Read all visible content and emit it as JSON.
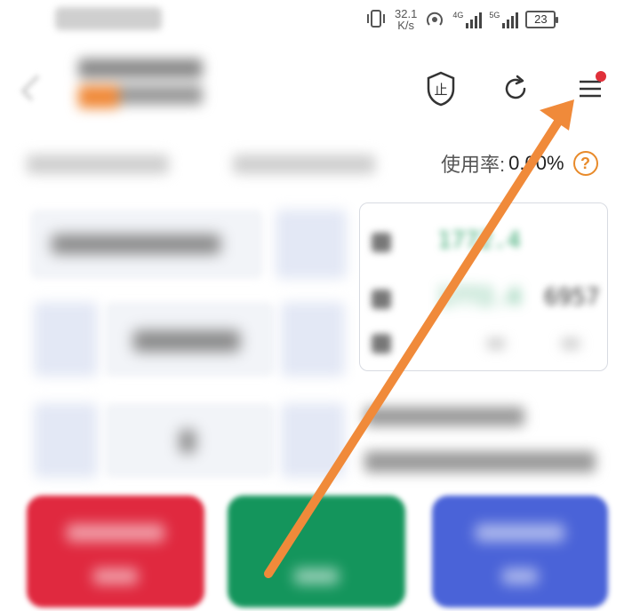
{
  "status_bar": {
    "speed_value": "32.1",
    "speed_unit": "K/s",
    "net1": "4G",
    "net2": "5G",
    "battery": "23"
  },
  "header": {
    "icons": [
      "stop-shield-icon",
      "refresh-icon",
      "menu-icon"
    ],
    "shield_glyph": "止"
  },
  "usage": {
    "label": "使用率:",
    "value": "0.00%",
    "help_glyph": "?"
  },
  "orderbook": {
    "ask_price": "1772.4",
    "bid_price": "1772.4",
    "volume": "6957"
  },
  "colors": {
    "buy": "#e0293f",
    "sell": "#14955c",
    "close": "#4a63d8",
    "accent": "#f08a3a",
    "annotation_arrow": "#f08a3a",
    "notification_dot": "#e0303a"
  }
}
